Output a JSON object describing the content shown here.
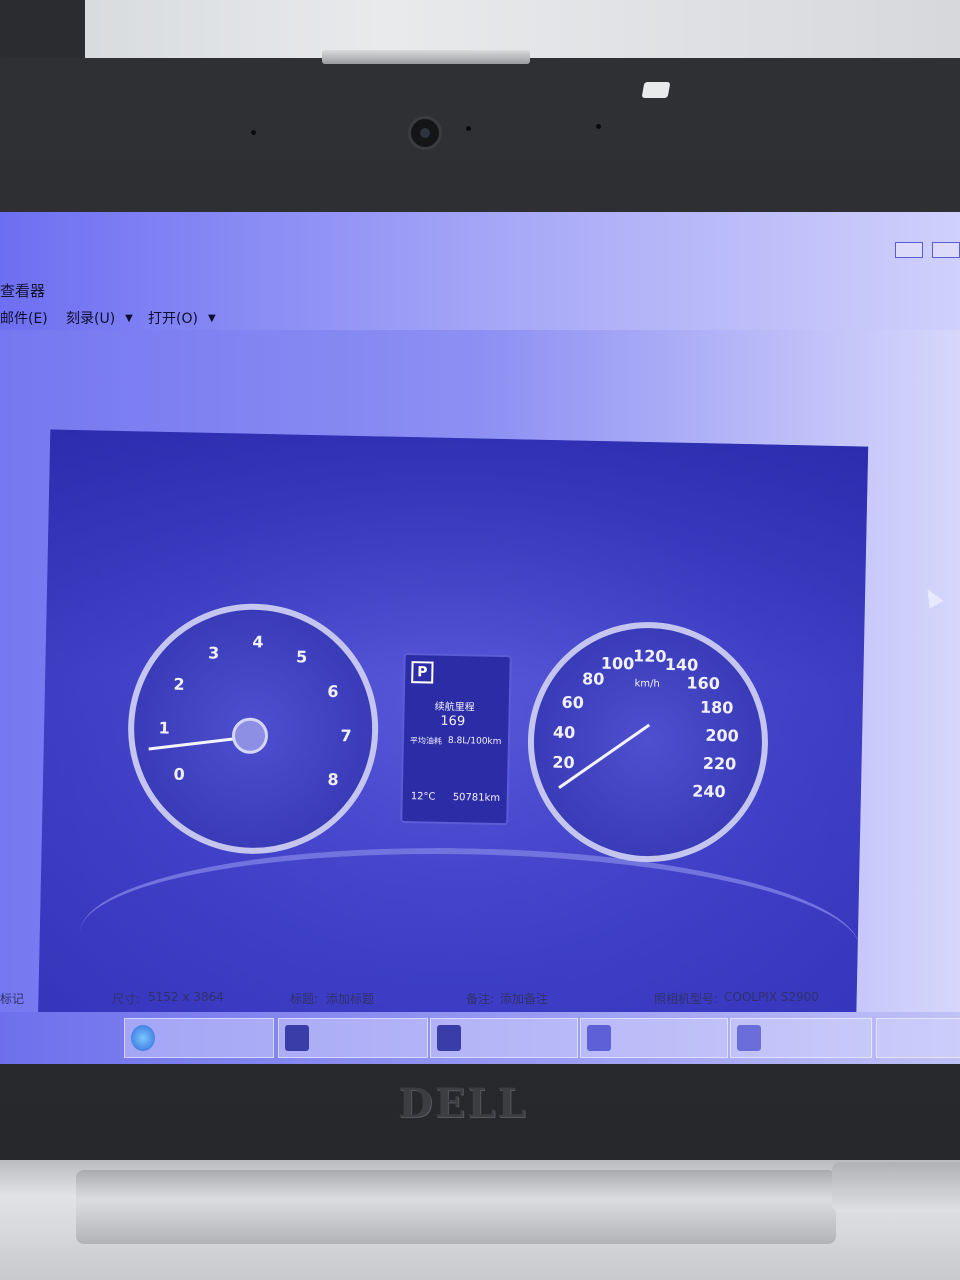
{
  "window": {
    "title": "查看器"
  },
  "menu": {
    "items": [
      {
        "label": "邮件(E)",
        "has_caret": false
      },
      {
        "label": "刻录(U)",
        "has_caret": true
      },
      {
        "label": "打开(O)",
        "has_caret": true
      }
    ]
  },
  "photo": {
    "tachometer_labels": [
      "1",
      "2",
      "3",
      "4",
      "5",
      "6",
      "7",
      "8",
      "0"
    ],
    "speedometer_labels": [
      "20",
      "40",
      "60",
      "80",
      "100",
      "120",
      "140",
      "160",
      "180",
      "200",
      "220",
      "240"
    ],
    "speed_unit": "km/h",
    "display": {
      "gear": "P",
      "trip_label": "续航里程",
      "trip_value": "169",
      "avg_label": "平均油耗",
      "avg_value": "8.8L/100km",
      "temperature": "12°C",
      "odometer": "50781km"
    }
  },
  "toolbar": {
    "zoom": "zoom-icon",
    "fit": "fit-icon",
    "prev": "previous-icon",
    "slideshow": "slideshow-icon",
    "next": "next-icon",
    "rotate_left": "rotate-left-icon",
    "rotate_right": "rotate-right-icon",
    "delete": "delete-icon"
  },
  "status": {
    "label_left": "标记",
    "dimensions_label": "尺寸:",
    "dimensions": "5152 x 3864",
    "title_label": "标题:",
    "title_value": "添加标题",
    "comment_label": "备注:",
    "comment_value": "添加备注",
    "camera_label": "照相机型号:",
    "camera_value": "COOLPIX S2900"
  },
  "brand": "DELL"
}
